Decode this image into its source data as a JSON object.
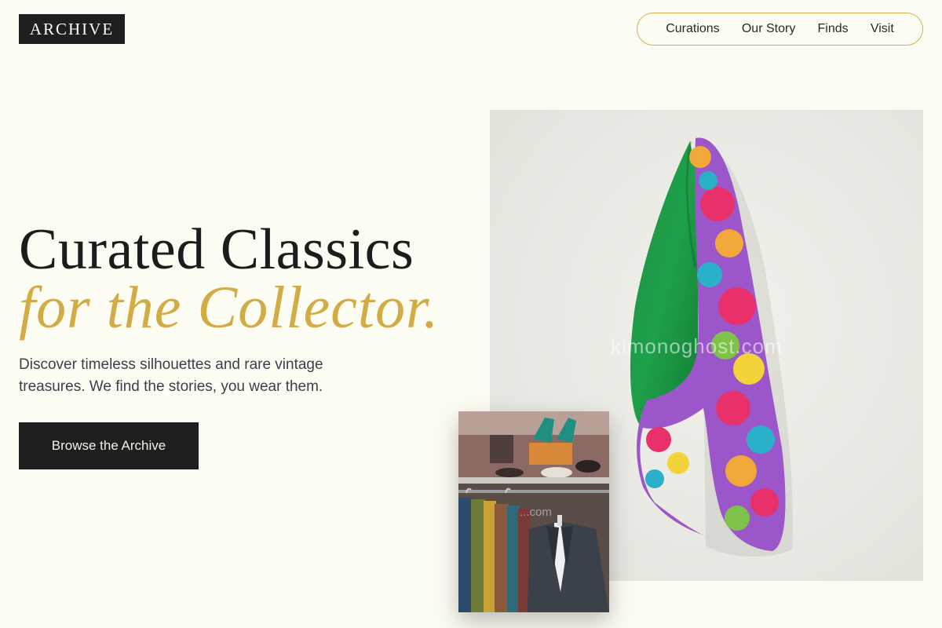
{
  "header": {
    "logo": "ARCHIVE",
    "nav": [
      {
        "label": "Curations"
      },
      {
        "label": "Our Story"
      },
      {
        "label": "Finds"
      },
      {
        "label": "Visit"
      }
    ]
  },
  "hero": {
    "headline": "Curated Classics",
    "headline_accent": "for the Collector.",
    "subtext": "Discover timeless silhouettes and rare vintage treasures. We find the stories, you wear them.",
    "cta": "Browse the Archive"
  },
  "images": {
    "main": {
      "depicts": "vintage-jacket",
      "watermark": "kimonoghost.com"
    },
    "secondary": {
      "depicts": "clothing-rack",
      "watermark": "...com"
    }
  },
  "colors": {
    "background": "#fdfcf3",
    "accent": "#d1ac45",
    "dark": "#1f1f1f",
    "body_text": "#3b3f4a"
  }
}
